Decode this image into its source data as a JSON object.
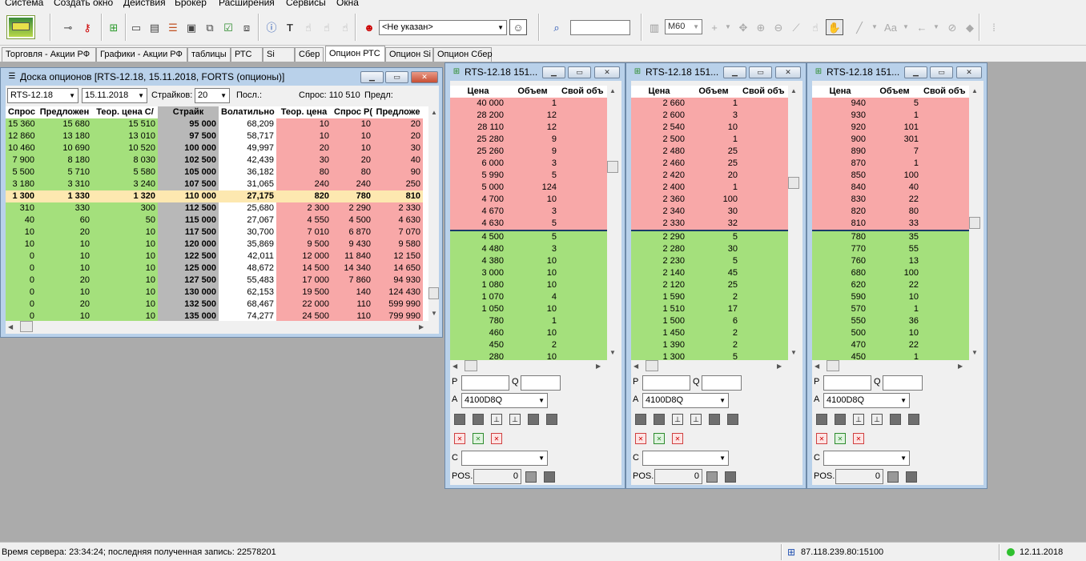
{
  "menu": [
    "Система",
    "Создать окно",
    "Действия",
    "Брокер",
    "Расширения",
    "Сервисы",
    "Окна"
  ],
  "toolbar": {
    "account_value": "<Не указан>",
    "search_placeholder": "",
    "timeframe": "M60"
  },
  "tabs": [
    {
      "label": "Торговля - Акции РФ",
      "active": false
    },
    {
      "label": "Графики - Акции РФ",
      "active": false
    },
    {
      "label": "таблицы",
      "active": false
    },
    {
      "label": "РТС",
      "active": false
    },
    {
      "label": "Si",
      "active": false
    },
    {
      "label": "Сбер",
      "active": false
    },
    {
      "label": "Опцион РТС",
      "active": true
    },
    {
      "label": "Опцион Si",
      "active": false
    },
    {
      "label": "Опцион Сбер",
      "active": false
    }
  ],
  "board": {
    "title": "Доска опционов [RTS-12.18, 15.11.2018, FORTS (опционы)]",
    "instrument": "RTS-12.18",
    "expiry": "15.11.2018",
    "strikes_label": "Страйков:",
    "strikes_value": "20",
    "last_label": "Посл.:",
    "bid_label": "Спрос: 110 510",
    "offer_label": "Предл:",
    "columns": [
      "Спрос",
      "Предложен",
      "Теор. цена С/",
      "Страйк",
      "Волатильно",
      "Теор. цена",
      "Спрос Р(",
      "Предложе"
    ],
    "rows": [
      [
        "15 360",
        "15 680",
        "15 510",
        "95 000",
        "68,209",
        "10",
        "10",
        "20"
      ],
      [
        "12 860",
        "13 180",
        "13 010",
        "97 500",
        "58,717",
        "10",
        "10",
        "20"
      ],
      [
        "10 460",
        "10 690",
        "10 520",
        "100 000",
        "49,997",
        "20",
        "10",
        "30"
      ],
      [
        "7 900",
        "8 180",
        "8 030",
        "102 500",
        "42,439",
        "30",
        "20",
        "40"
      ],
      [
        "5 500",
        "5 710",
        "5 580",
        "105 000",
        "36,182",
        "80",
        "80",
        "90"
      ],
      [
        "3 180",
        "3 310",
        "3 240",
        "107 500",
        "31,065",
        "240",
        "240",
        "250"
      ],
      [
        "1 300",
        "1 330",
        "1 320",
        "110 000",
        "27,175",
        "820",
        "780",
        "810"
      ],
      [
        "310",
        "330",
        "300",
        "112 500",
        "25,680",
        "2 300",
        "2 290",
        "2 330"
      ],
      [
        "40",
        "60",
        "50",
        "115 000",
        "27,067",
        "4 550",
        "4 500",
        "4 630"
      ],
      [
        "10",
        "20",
        "10",
        "117 500",
        "30,700",
        "7 010",
        "6 870",
        "7 070"
      ],
      [
        "10",
        "10",
        "10",
        "120 000",
        "35,869",
        "9 500",
        "9 430",
        "9 580"
      ],
      [
        "0",
        "10",
        "10",
        "122 500",
        "42,011",
        "12 000",
        "11 840",
        "12 150"
      ],
      [
        "0",
        "10",
        "10",
        "125 000",
        "48,672",
        "14 500",
        "14 340",
        "14 650"
      ],
      [
        "0",
        "20",
        "10",
        "127 500",
        "55,483",
        "17 000",
        "7 860",
        "94 930"
      ],
      [
        "0",
        "10",
        "10",
        "130 000",
        "62,153",
        "19 500",
        "140",
        "124 430"
      ],
      [
        "0",
        "20",
        "10",
        "132 500",
        "68,467",
        "22 000",
        "110",
        "599 990"
      ],
      [
        "0",
        "10",
        "10",
        "135 000",
        "74,277",
        "24 500",
        "110",
        "799 990"
      ]
    ],
    "atm_row": 6
  },
  "glasses": [
    {
      "title": "RTS-12.18 151...",
      "columns": [
        "Цена",
        "Объем",
        "Свой объ"
      ],
      "asks": [
        [
          "40 000",
          "1"
        ],
        [
          "28 200",
          "12"
        ],
        [
          "28 110",
          "12"
        ],
        [
          "25 280",
          "9"
        ],
        [
          "25 260",
          "9"
        ],
        [
          "6 000",
          "3"
        ],
        [
          "5 990",
          "5"
        ],
        [
          "5 000",
          "124"
        ],
        [
          "4 700",
          "10"
        ],
        [
          "4 670",
          "3"
        ],
        [
          "4 630",
          "5"
        ]
      ],
      "bids": [
        [
          "4 500",
          "5"
        ],
        [
          "4 480",
          "3"
        ],
        [
          "4 380",
          "10"
        ],
        [
          "3 000",
          "10"
        ],
        [
          "1 080",
          "10"
        ],
        [
          "1 070",
          "4"
        ],
        [
          "1 050",
          "10"
        ],
        [
          "780",
          "1"
        ],
        [
          "460",
          "10"
        ],
        [
          "450",
          "2"
        ],
        [
          "280",
          "10"
        ]
      ],
      "account": "4100D8Q",
      "pos_label": "POS.",
      "pos_value": "0",
      "p_label": "P",
      "q_label": "Q",
      "a_label": "A",
      "c_label": "C"
    },
    {
      "title": "RTS-12.18 151...",
      "columns": [
        "Цена",
        "Объем",
        "Свой объ"
      ],
      "asks": [
        [
          "2 660",
          "1"
        ],
        [
          "2 600",
          "3"
        ],
        [
          "2 540",
          "10"
        ],
        [
          "2 500",
          "1"
        ],
        [
          "2 480",
          "25"
        ],
        [
          "2 460",
          "25"
        ],
        [
          "2 420",
          "20"
        ],
        [
          "2 400",
          "1"
        ],
        [
          "2 360",
          "100"
        ],
        [
          "2 340",
          "30"
        ],
        [
          "2 330",
          "32"
        ]
      ],
      "bids": [
        [
          "2 290",
          "5"
        ],
        [
          "2 280",
          "30"
        ],
        [
          "2 230",
          "5"
        ],
        [
          "2 140",
          "45"
        ],
        [
          "2 120",
          "25"
        ],
        [
          "1 590",
          "2"
        ],
        [
          "1 510",
          "17"
        ],
        [
          "1 500",
          "6"
        ],
        [
          "1 450",
          "2"
        ],
        [
          "1 390",
          "2"
        ],
        [
          "1 300",
          "5"
        ]
      ],
      "account": "4100D8Q",
      "pos_label": "POS.",
      "pos_value": "0",
      "p_label": "P",
      "q_label": "Q",
      "a_label": "A",
      "c_label": "C"
    },
    {
      "title": "RTS-12.18 151...",
      "columns": [
        "Цена",
        "Объем",
        "Свой объ"
      ],
      "asks": [
        [
          "940",
          "5"
        ],
        [
          "930",
          "1"
        ],
        [
          "920",
          "101"
        ],
        [
          "900",
          "301"
        ],
        [
          "890",
          "7"
        ],
        [
          "870",
          "1"
        ],
        [
          "850",
          "100"
        ],
        [
          "840",
          "40"
        ],
        [
          "830",
          "22"
        ],
        [
          "820",
          "80"
        ],
        [
          "810",
          "33"
        ]
      ],
      "bids": [
        [
          "780",
          "35"
        ],
        [
          "770",
          "55"
        ],
        [
          "760",
          "13"
        ],
        [
          "680",
          "100"
        ],
        [
          "620",
          "22"
        ],
        [
          "590",
          "10"
        ],
        [
          "570",
          "1"
        ],
        [
          "550",
          "36"
        ],
        [
          "500",
          "10"
        ],
        [
          "470",
          "22"
        ],
        [
          "450",
          "1"
        ]
      ],
      "account": "4100D8Q",
      "pos_label": "POS.",
      "pos_value": "0",
      "p_label": "P",
      "q_label": "Q",
      "a_label": "A",
      "c_label": "C"
    }
  ],
  "status": {
    "server_time": "Время сервера: 23:34:24; последняя полученная запись: 22578201",
    "connection": "87.118.239.80:15100",
    "date": "12.11.2018"
  },
  "colors": {
    "ask_bg": "#f8a8a8",
    "bid_bg": "#a4e07c",
    "strike_bg": "#b8b8b8",
    "atm_bg": "#fde8b0",
    "window_frame": "#b9d1ea"
  }
}
